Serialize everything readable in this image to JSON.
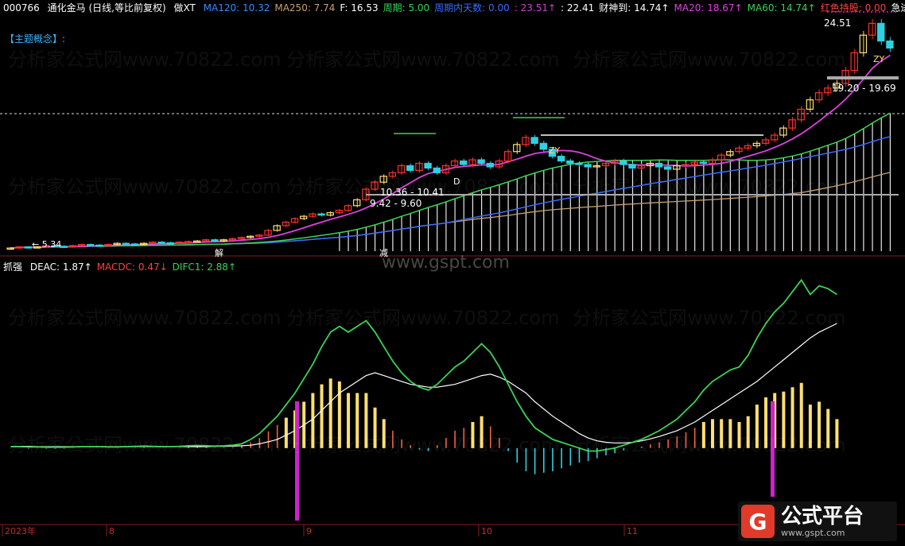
{
  "topbar": {
    "code": "000766",
    "name": "通化金马",
    "period": "(日线,等比前复权)",
    "indicator": "做XT",
    "items": [
      {
        "label": "MA120: 10.32",
        "color": "#3a8bff"
      },
      {
        "label": "MA250: 7.74",
        "color": "#c8a070"
      },
      {
        "label": "F: 16.53",
        "color": "#ffffff"
      },
      {
        "label": "周期: 5.00",
        "color": "#39d353"
      },
      {
        "label": "周期内天数: 0.00",
        "color": "#3a6bff"
      },
      {
        "label": ": 23.51↑",
        "color": "#d040d0"
      },
      {
        "label": ": 22.41",
        "color": "#ffffff"
      },
      {
        "label": "财神到: 14.74↑",
        "color": "#ffffff"
      },
      {
        "label": "MA20: 18.67↑",
        "color": "#e040e0"
      },
      {
        "label": "MA60: 14.74↑",
        "color": "#39d353"
      },
      {
        "label": "红色持股: 0.00",
        "color": "#ff4040"
      },
      {
        "label": "急进",
        "color": "#ffffff"
      }
    ]
  },
  "concept_label": "【主题概念】:",
  "subbar": {
    "name": "抓强",
    "items": [
      {
        "label": "DEAC: 1.87↑",
        "color": "#ffffff"
      },
      {
        "label": "MACDC: 0.47↓",
        "color": "#ff4040"
      },
      {
        "label": "DIFC1: 2.88↑",
        "color": "#39d353"
      }
    ]
  },
  "annotations": {
    "high": "24.51",
    "range1": "19.20 - 19.69",
    "range2": "10.36 - 10.41",
    "range3": "9.42 - 9.60",
    "low": "5.34",
    "mark_jie": "解",
    "mark_jian": "减",
    "mark_zy": "ZY",
    "mark_d": "D"
  },
  "watermarks": [
    "分析家公式网www.70822.com",
    "www.gspt.com"
  ],
  "logo": {
    "mark": "G",
    "title": "公式平台",
    "url": "www.gspt.com"
  },
  "chart_data": [
    {
      "type": "candlestick",
      "title": "通化金马 (日线,等比前复权)",
      "x_labels": [
        "2023年",
        "8",
        "9",
        "10",
        "11"
      ],
      "ylim": [
        5.0,
        25.0
      ],
      "close": [
        5.4,
        5.5,
        5.45,
        5.5,
        5.6,
        5.55,
        5.5,
        5.6,
        5.7,
        5.65,
        5.6,
        5.7,
        5.8,
        5.75,
        5.7,
        5.8,
        5.9,
        5.85,
        5.8,
        5.9,
        5.95,
        6.0,
        6.1,
        6.0,
        6.1,
        6.2,
        6.3,
        6.4,
        6.5,
        6.9,
        7.3,
        7.6,
        7.9,
        8.1,
        8.3,
        8.2,
        8.4,
        8.6,
        9.0,
        9.5,
        10.4,
        11.0,
        11.5,
        11.8,
        12.4,
        12.0,
        12.6,
        12.2,
        11.8,
        12.4,
        12.8,
        12.5,
        12.9,
        12.6,
        12.3,
        12.8,
        13.6,
        14.2,
        14.8,
        14.3,
        13.8,
        13.2,
        12.8,
        12.6,
        12.5,
        12.3,
        12.4,
        12.6,
        12.8,
        12.5,
        12.2,
        12.4,
        12.6,
        12.3,
        12.1,
        12.4,
        12.5,
        12.7,
        12.6,
        12.9,
        13.3,
        13.6,
        13.9,
        14.1,
        14.3,
        14.6,
        15.0,
        15.6,
        16.3,
        17.2,
        18.0,
        18.6,
        19.0,
        19.4,
        20.5,
        22.0,
        23.5,
        24.5,
        23.0,
        22.4
      ],
      "ma20_last": 18.67,
      "ma60_last": 14.74,
      "ma120_last": 10.32,
      "ma250_last": 7.74
    },
    {
      "type": "macd",
      "title": "抓强",
      "ylim": [
        -2.5,
        6.0
      ],
      "difc": [
        0.05,
        0.05,
        0.04,
        0.04,
        0.03,
        0.03,
        0.03,
        0.04,
        0.05,
        0.05,
        0.05,
        0.04,
        0.04,
        0.05,
        0.06,
        0.07,
        0.06,
        0.05,
        0.05,
        0.06,
        0.08,
        0.09,
        0.08,
        0.07,
        0.08,
        0.1,
        0.15,
        0.3,
        0.5,
        0.8,
        1.1,
        1.5,
        1.9,
        2.4,
        2.9,
        3.5,
        4.0,
        4.2,
        4.0,
        4.2,
        4.4,
        4.0,
        3.5,
        3.0,
        2.6,
        2.3,
        2.1,
        2.0,
        2.2,
        2.5,
        2.8,
        3.0,
        3.3,
        3.6,
        3.3,
        2.8,
        2.2,
        1.6,
        1.1,
        0.7,
        0.5,
        0.3,
        0.2,
        0.1,
        0.0,
        -0.1,
        -0.1,
        -0.05,
        0.0,
        0.1,
        0.2,
        0.3,
        0.45,
        0.6,
        0.8,
        1.0,
        1.3,
        1.6,
        2.0,
        2.3,
        2.5,
        2.7,
        2.8,
        3.2,
        3.8,
        4.3,
        4.7,
        5.0,
        5.4,
        5.8,
        5.3,
        5.6,
        5.5,
        5.3
      ],
      "deac": [
        0.06,
        0.06,
        0.06,
        0.05,
        0.05,
        0.05,
        0.05,
        0.05,
        0.05,
        0.05,
        0.05,
        0.05,
        0.05,
        0.05,
        0.05,
        0.05,
        0.05,
        0.05,
        0.05,
        0.05,
        0.05,
        0.05,
        0.05,
        0.06,
        0.06,
        0.07,
        0.08,
        0.1,
        0.15,
        0.22,
        0.3,
        0.45,
        0.6,
        0.8,
        1.0,
        1.3,
        1.6,
        1.9,
        2.1,
        2.3,
        2.5,
        2.6,
        2.5,
        2.4,
        2.3,
        2.2,
        2.15,
        2.1,
        2.1,
        2.15,
        2.2,
        2.3,
        2.4,
        2.5,
        2.55,
        2.45,
        2.3,
        2.1,
        1.9,
        1.6,
        1.35,
        1.1,
        0.9,
        0.7,
        0.5,
        0.35,
        0.25,
        0.2,
        0.18,
        0.18,
        0.2,
        0.25,
        0.32,
        0.4,
        0.5,
        0.6,
        0.75,
        0.9,
        1.1,
        1.3,
        1.5,
        1.7,
        1.9,
        2.1,
        2.3,
        2.55,
        2.8,
        3.05,
        3.3,
        3.55,
        3.8,
        4.0,
        4.15,
        4.3
      ],
      "last": {
        "DEAC": 1.87,
        "MACDC": 0.47,
        "DIFC1": 2.88
      }
    }
  ],
  "colors": {
    "up": "#ff3030",
    "down": "#30d0e0",
    "yellow": "#ffe070",
    "ma20": "#e040e0",
    "ma60": "#39d353",
    "ma120": "#3a6bff",
    "ma250": "#c8a070",
    "magenta": "#d020d0"
  }
}
